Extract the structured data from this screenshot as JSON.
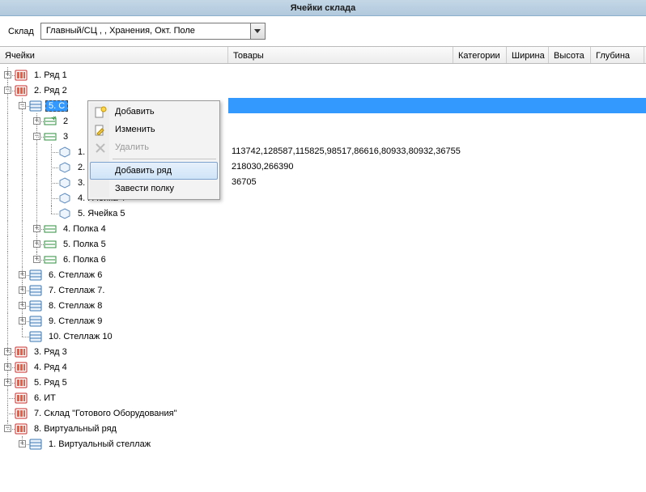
{
  "title": "Ячейки склада",
  "warehouse_label": "Склад",
  "warehouse_value": "Главный/СЦ , , Хранения, Окт. Поле",
  "columns": {
    "cells": "Ячейки",
    "goods": "Товары",
    "categories": "Категории",
    "width": "Ширина",
    "height": "Высота",
    "depth": "Глубина"
  },
  "tree": {
    "row1": "1. Ряд 1",
    "row2": "2. Ряд 2",
    "rack5": "5. С",
    "shelf2": "2",
    "shelf3": "3",
    "cell1_label": "1. Ячейка 1",
    "cell2_label": "2. Ячейка 2",
    "cell3": "3. Ячейка 3",
    "cell4": "4. Ячейка 4",
    "cell5": "5. Ячейка 5",
    "shelf4": "4. Полка 4",
    "shelf5": "5. Полка 5",
    "shelf6": "6. Полка 6",
    "rack6": "6. Стеллаж 6",
    "rack7": "7. Стеллаж 7.",
    "rack8": "8. Стеллаж 8",
    "rack9": "9. Стеллаж 9",
    "rack10": "10. Стеллаж 10",
    "row3": "3. Ряд 3",
    "row4": "4. Ряд 4",
    "row5": "5. Ряд 5",
    "row6": "6. ИТ",
    "row7": "7. Склад \"Готового Оборудования\"",
    "row8": "8. Виртуальный ряд",
    "vrack1": "1. Виртуальный стеллаж"
  },
  "goods": {
    "cell1": "113742,128587,115825,98517,86616,80933,80932,36755",
    "cell2": "218030,266390",
    "cell3": "36705"
  },
  "context_menu": {
    "add": "Добавить",
    "edit": "Изменить",
    "delete": "Удалить",
    "add_row": "Добавить ряд",
    "add_shelf": "Завести полку"
  }
}
